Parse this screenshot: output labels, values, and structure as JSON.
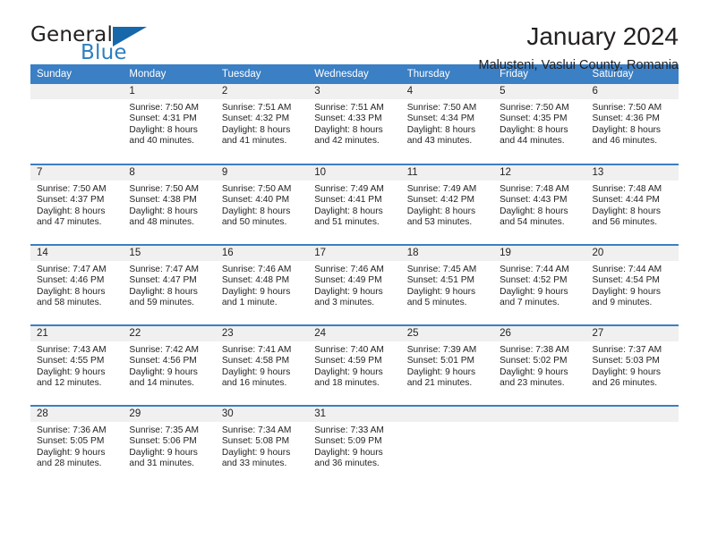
{
  "brand": {
    "name_part1": "General",
    "name_part2": "Blue",
    "triangle_icon": "triangle-icon",
    "colors": {
      "dark": "#231f20",
      "blue": "#2b7fc1",
      "triangle": "#1668ab"
    }
  },
  "header": {
    "title": "January 2024",
    "subtitle": "Malusteni, Vaslui County, Romania"
  },
  "calendar": {
    "header_bg": "#3b7fc4",
    "daynum_bg": "#f0f0f0",
    "weekdays": [
      "Sunday",
      "Monday",
      "Tuesday",
      "Wednesday",
      "Thursday",
      "Friday",
      "Saturday"
    ],
    "weeks": [
      [
        {
          "day": "",
          "lines": []
        },
        {
          "day": "1",
          "lines": [
            "Sunrise: 7:50 AM",
            "Sunset: 4:31 PM",
            "Daylight: 8 hours",
            "and 40 minutes."
          ]
        },
        {
          "day": "2",
          "lines": [
            "Sunrise: 7:51 AM",
            "Sunset: 4:32 PM",
            "Daylight: 8 hours",
            "and 41 minutes."
          ]
        },
        {
          "day": "3",
          "lines": [
            "Sunrise: 7:51 AM",
            "Sunset: 4:33 PM",
            "Daylight: 8 hours",
            "and 42 minutes."
          ]
        },
        {
          "day": "4",
          "lines": [
            "Sunrise: 7:50 AM",
            "Sunset: 4:34 PM",
            "Daylight: 8 hours",
            "and 43 minutes."
          ]
        },
        {
          "day": "5",
          "lines": [
            "Sunrise: 7:50 AM",
            "Sunset: 4:35 PM",
            "Daylight: 8 hours",
            "and 44 minutes."
          ]
        },
        {
          "day": "6",
          "lines": [
            "Sunrise: 7:50 AM",
            "Sunset: 4:36 PM",
            "Daylight: 8 hours",
            "and 46 minutes."
          ]
        }
      ],
      [
        {
          "day": "7",
          "lines": [
            "Sunrise: 7:50 AM",
            "Sunset: 4:37 PM",
            "Daylight: 8 hours",
            "and 47 minutes."
          ]
        },
        {
          "day": "8",
          "lines": [
            "Sunrise: 7:50 AM",
            "Sunset: 4:38 PM",
            "Daylight: 8 hours",
            "and 48 minutes."
          ]
        },
        {
          "day": "9",
          "lines": [
            "Sunrise: 7:50 AM",
            "Sunset: 4:40 PM",
            "Daylight: 8 hours",
            "and 50 minutes."
          ]
        },
        {
          "day": "10",
          "lines": [
            "Sunrise: 7:49 AM",
            "Sunset: 4:41 PM",
            "Daylight: 8 hours",
            "and 51 minutes."
          ]
        },
        {
          "day": "11",
          "lines": [
            "Sunrise: 7:49 AM",
            "Sunset: 4:42 PM",
            "Daylight: 8 hours",
            "and 53 minutes."
          ]
        },
        {
          "day": "12",
          "lines": [
            "Sunrise: 7:48 AM",
            "Sunset: 4:43 PM",
            "Daylight: 8 hours",
            "and 54 minutes."
          ]
        },
        {
          "day": "13",
          "lines": [
            "Sunrise: 7:48 AM",
            "Sunset: 4:44 PM",
            "Daylight: 8 hours",
            "and 56 minutes."
          ]
        }
      ],
      [
        {
          "day": "14",
          "lines": [
            "Sunrise: 7:47 AM",
            "Sunset: 4:46 PM",
            "Daylight: 8 hours",
            "and 58 minutes."
          ]
        },
        {
          "day": "15",
          "lines": [
            "Sunrise: 7:47 AM",
            "Sunset: 4:47 PM",
            "Daylight: 8 hours",
            "and 59 minutes."
          ]
        },
        {
          "day": "16",
          "lines": [
            "Sunrise: 7:46 AM",
            "Sunset: 4:48 PM",
            "Daylight: 9 hours",
            "and 1 minute."
          ]
        },
        {
          "day": "17",
          "lines": [
            "Sunrise: 7:46 AM",
            "Sunset: 4:49 PM",
            "Daylight: 9 hours",
            "and 3 minutes."
          ]
        },
        {
          "day": "18",
          "lines": [
            "Sunrise: 7:45 AM",
            "Sunset: 4:51 PM",
            "Daylight: 9 hours",
            "and 5 minutes."
          ]
        },
        {
          "day": "19",
          "lines": [
            "Sunrise: 7:44 AM",
            "Sunset: 4:52 PM",
            "Daylight: 9 hours",
            "and 7 minutes."
          ]
        },
        {
          "day": "20",
          "lines": [
            "Sunrise: 7:44 AM",
            "Sunset: 4:54 PM",
            "Daylight: 9 hours",
            "and 9 minutes."
          ]
        }
      ],
      [
        {
          "day": "21",
          "lines": [
            "Sunrise: 7:43 AM",
            "Sunset: 4:55 PM",
            "Daylight: 9 hours",
            "and 12 minutes."
          ]
        },
        {
          "day": "22",
          "lines": [
            "Sunrise: 7:42 AM",
            "Sunset: 4:56 PM",
            "Daylight: 9 hours",
            "and 14 minutes."
          ]
        },
        {
          "day": "23",
          "lines": [
            "Sunrise: 7:41 AM",
            "Sunset: 4:58 PM",
            "Daylight: 9 hours",
            "and 16 minutes."
          ]
        },
        {
          "day": "24",
          "lines": [
            "Sunrise: 7:40 AM",
            "Sunset: 4:59 PM",
            "Daylight: 9 hours",
            "and 18 minutes."
          ]
        },
        {
          "day": "25",
          "lines": [
            "Sunrise: 7:39 AM",
            "Sunset: 5:01 PM",
            "Daylight: 9 hours",
            "and 21 minutes."
          ]
        },
        {
          "day": "26",
          "lines": [
            "Sunrise: 7:38 AM",
            "Sunset: 5:02 PM",
            "Daylight: 9 hours",
            "and 23 minutes."
          ]
        },
        {
          "day": "27",
          "lines": [
            "Sunrise: 7:37 AM",
            "Sunset: 5:03 PM",
            "Daylight: 9 hours",
            "and 26 minutes."
          ]
        }
      ],
      [
        {
          "day": "28",
          "lines": [
            "Sunrise: 7:36 AM",
            "Sunset: 5:05 PM",
            "Daylight: 9 hours",
            "and 28 minutes."
          ]
        },
        {
          "day": "29",
          "lines": [
            "Sunrise: 7:35 AM",
            "Sunset: 5:06 PM",
            "Daylight: 9 hours",
            "and 31 minutes."
          ]
        },
        {
          "day": "30",
          "lines": [
            "Sunrise: 7:34 AM",
            "Sunset: 5:08 PM",
            "Daylight: 9 hours",
            "and 33 minutes."
          ]
        },
        {
          "day": "31",
          "lines": [
            "Sunrise: 7:33 AM",
            "Sunset: 5:09 PM",
            "Daylight: 9 hours",
            "and 36 minutes."
          ]
        },
        {
          "day": "",
          "lines": []
        },
        {
          "day": "",
          "lines": []
        },
        {
          "day": "",
          "lines": []
        }
      ]
    ]
  }
}
